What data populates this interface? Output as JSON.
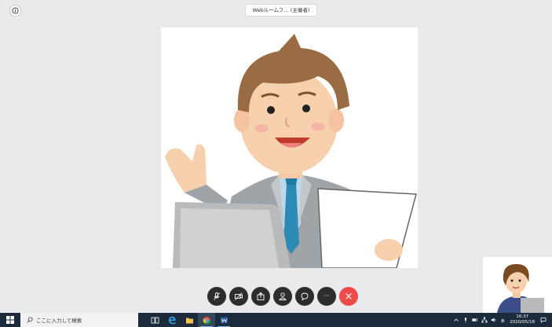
{
  "window": {
    "title": "Webルームフ… (主催者)"
  },
  "controls": [
    {
      "name": "mute-mic-button",
      "icon": "mic-off-icon"
    },
    {
      "name": "stop-video-button",
      "icon": "camera-off-icon"
    },
    {
      "name": "share-screen-button",
      "icon": "share-icon"
    },
    {
      "name": "participants-button",
      "icon": "person-icon"
    },
    {
      "name": "chat-button",
      "icon": "chat-icon"
    },
    {
      "name": "more-button",
      "icon": "more-icon",
      "label": "···"
    },
    {
      "name": "leave-button",
      "icon": "close-icon",
      "label": "×"
    }
  ],
  "taskbar": {
    "search_placeholder": "ここに入力して検索",
    "time": "16:37",
    "date": "2020/05/18",
    "ime_label": "ぁ"
  },
  "colors": {
    "background": "#e9eaec",
    "control": "#2d2d2d",
    "hangup": "#ee4a4a",
    "taskbar": "#1b2b3c"
  }
}
